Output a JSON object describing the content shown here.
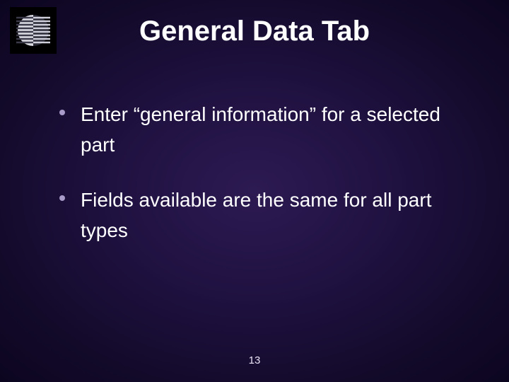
{
  "title": "General Data Tab",
  "bullets": [
    "Enter “general information” for a selected part",
    "Fields available are the same for all part types"
  ],
  "page_number": "13"
}
